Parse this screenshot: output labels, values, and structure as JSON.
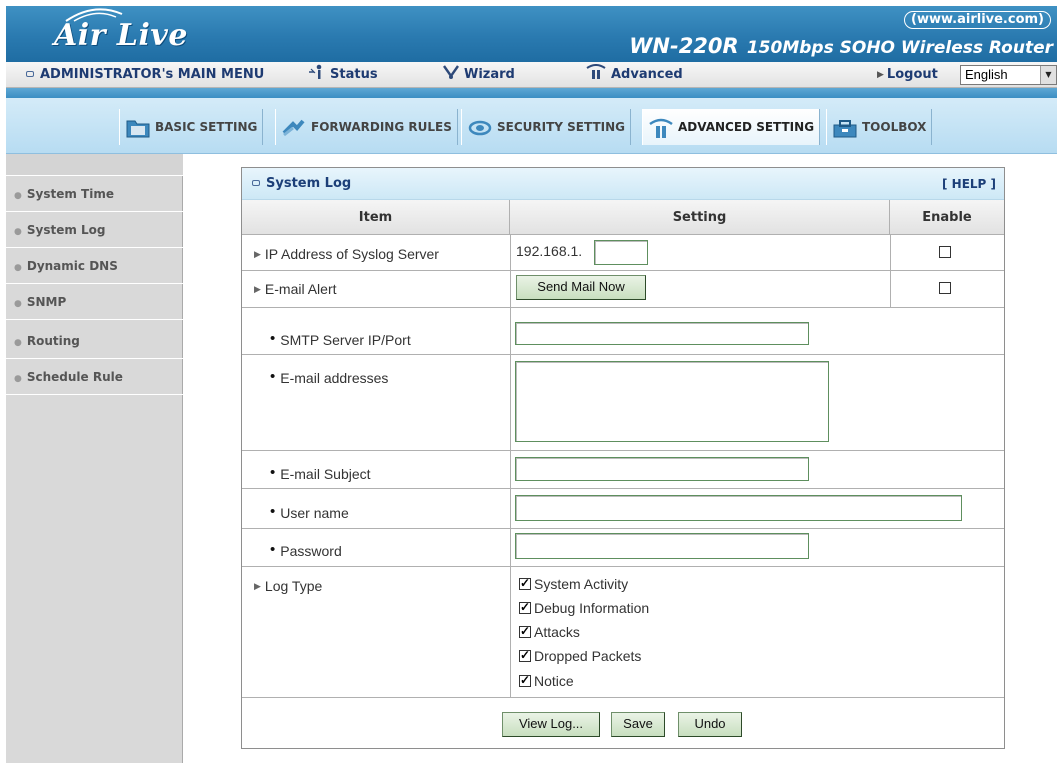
{
  "header": {
    "logo_text": "Air Live",
    "url": "(www.airlive.com)",
    "model": "WN-220R",
    "product_desc": "150Mbps SOHO Wireless Router"
  },
  "main_menu": {
    "admin_label": "ADMINISTRATOR's MAIN MENU",
    "status_label": "Status",
    "wizard_label": "Wizard",
    "advanced_label": "Advanced",
    "logout_label": "Logout",
    "language": "English"
  },
  "tabs": [
    {
      "label": "BASIC SETTING"
    },
    {
      "label": "FORWARDING RULES"
    },
    {
      "label": "SECURITY SETTING"
    },
    {
      "label": "ADVANCED SETTING"
    },
    {
      "label": "TOOLBOX"
    }
  ],
  "sidebar": {
    "items": [
      {
        "label": "System Time"
      },
      {
        "label": "System Log"
      },
      {
        "label": "Dynamic DNS"
      },
      {
        "label": "SNMP"
      },
      {
        "label": "Routing"
      },
      {
        "label": "Schedule Rule"
      }
    ]
  },
  "panel": {
    "title": "System Log",
    "help": "[ HELP ]",
    "col_item": "Item",
    "col_setting": "Setting",
    "col_enable": "Enable",
    "syslog_label": "IP Address of Syslog Server",
    "syslog_prefix": "192.168.1.",
    "syslog_value": "",
    "syslog_enabled": false,
    "email_alert_label": "E-mail Alert",
    "send_mail_label": "Send Mail Now",
    "email_alert_enabled": false,
    "smtp_label": "SMTP Server IP/Port",
    "smtp_value": "",
    "addresses_label": "E-mail addresses",
    "addresses_value": "",
    "subject_label": "E-mail Subject",
    "subject_value": "",
    "username_label": "User name",
    "username_value": "",
    "password_label": "Password",
    "password_value": "",
    "log_type_label": "Log Type",
    "log_types": [
      {
        "label": "System Activity",
        "checked": true
      },
      {
        "label": "Debug Information",
        "checked": true
      },
      {
        "label": "Attacks",
        "checked": true
      },
      {
        "label": "Dropped Packets",
        "checked": true
      },
      {
        "label": "Notice",
        "checked": true
      }
    ],
    "view_log_label": "View Log...",
    "save_label": "Save",
    "undo_label": "Undo"
  }
}
